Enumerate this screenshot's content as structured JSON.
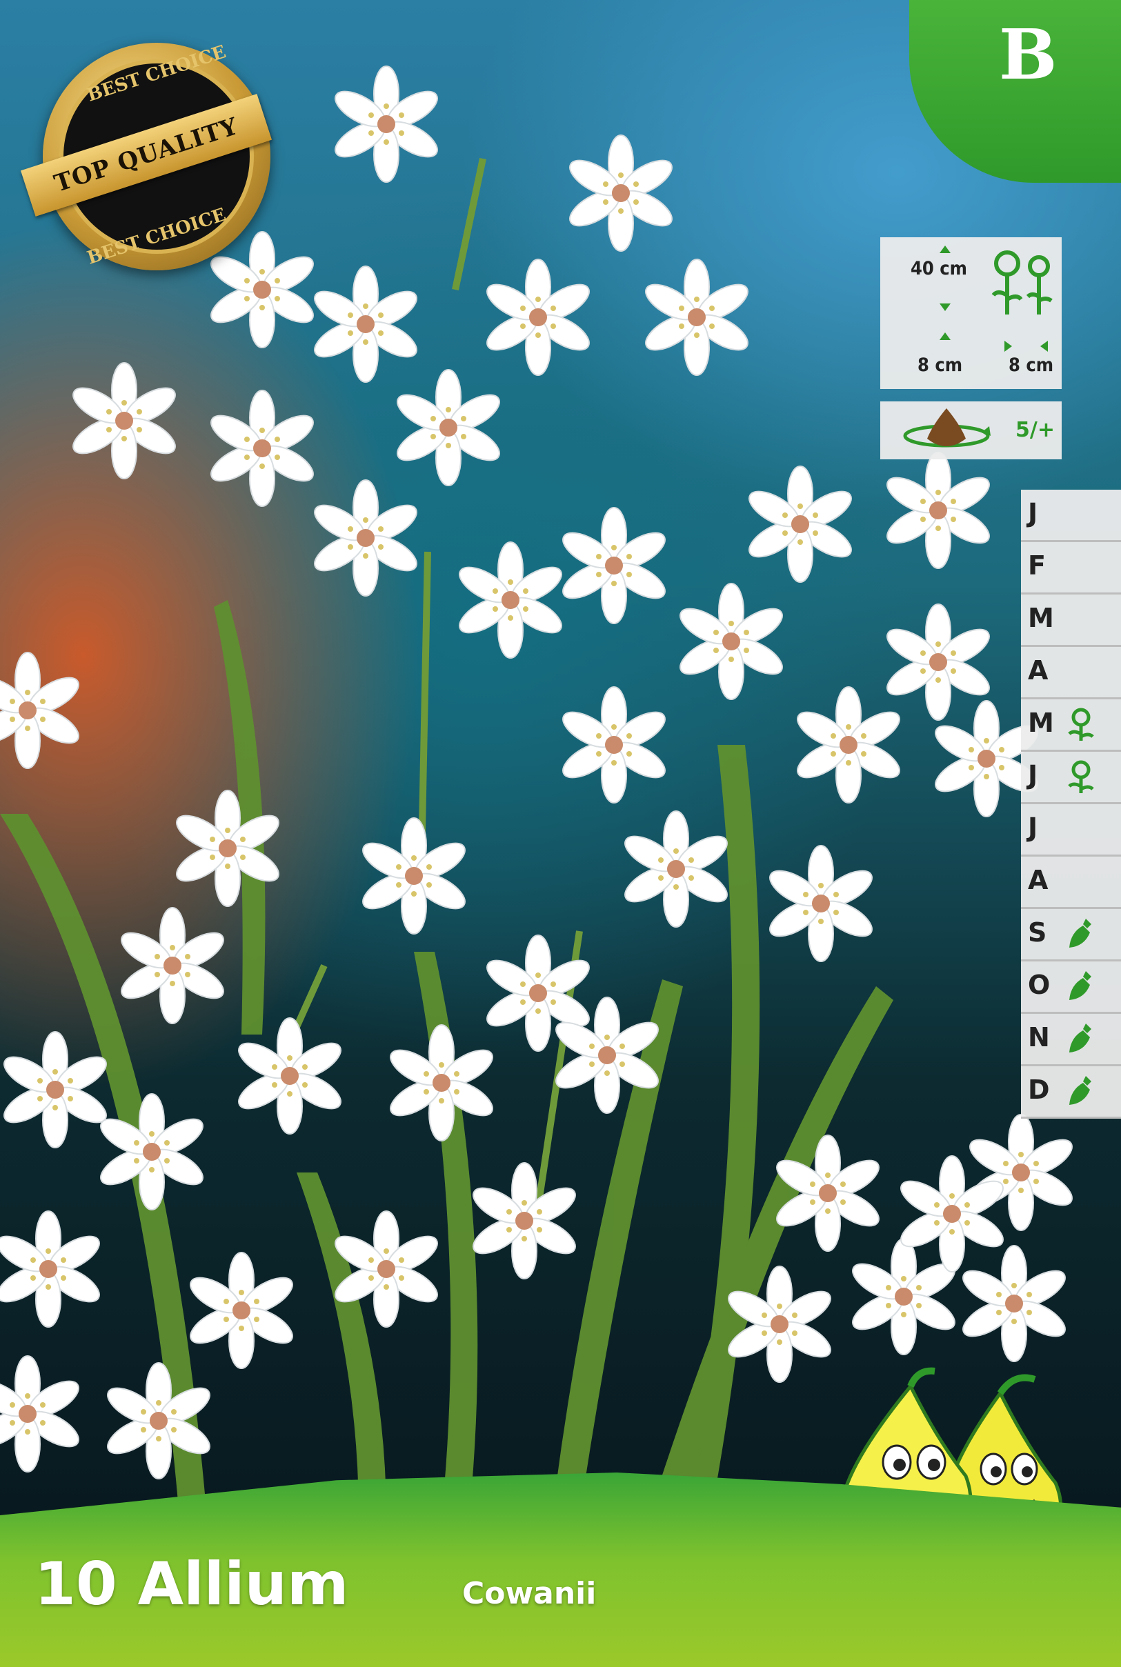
{
  "badge": {
    "top_text": "BEST CHOICE",
    "banner_text": "TOP QUALITY",
    "bottom_text": "BEST CHOICE"
  },
  "category_letter": "B",
  "info": {
    "height": "40 cm",
    "depth": "8 cm",
    "spacing": "8 cm",
    "bulbs_per_sq": "5/+"
  },
  "months": [
    {
      "label": "J",
      "icon": ""
    },
    {
      "label": "F",
      "icon": ""
    },
    {
      "label": "M",
      "icon": ""
    },
    {
      "label": "A",
      "icon": ""
    },
    {
      "label": "M",
      "icon": "flower-icon"
    },
    {
      "label": "J",
      "icon": "flower-icon"
    },
    {
      "label": "J",
      "icon": ""
    },
    {
      "label": "A",
      "icon": ""
    },
    {
      "label": "S",
      "icon": "trowel-icon"
    },
    {
      "label": "O",
      "icon": "trowel-icon"
    },
    {
      "label": "N",
      "icon": "trowel-icon"
    },
    {
      "label": "D",
      "icon": "trowel-icon"
    }
  ],
  "product": {
    "title": "10 Allium",
    "variety": "Cowanii"
  },
  "colors": {
    "brand_green": "#2f9a2a",
    "banner_light": "#9bc92a",
    "panel": "#ececec"
  }
}
